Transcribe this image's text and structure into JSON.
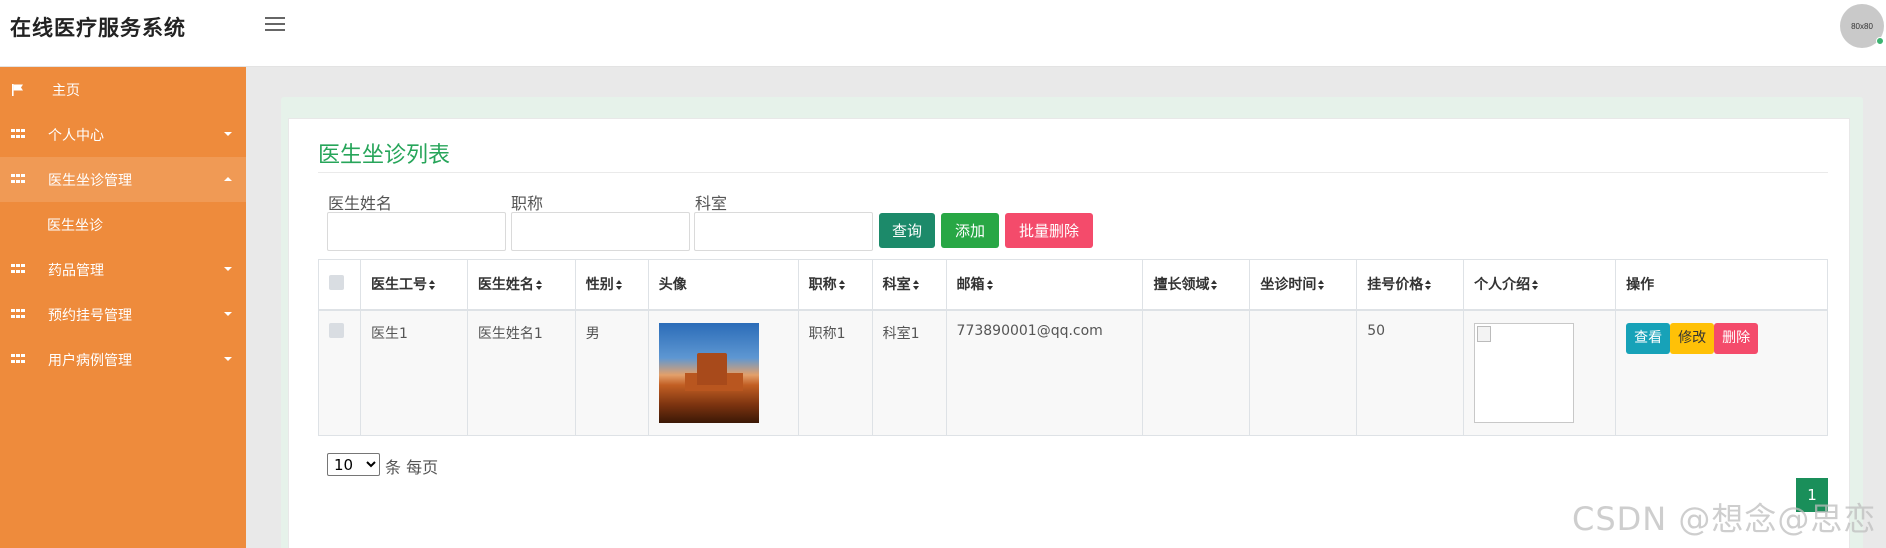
{
  "header": {
    "title": "在线医疗服务系统",
    "avatar_text": "80x80"
  },
  "sidebar": {
    "items": [
      {
        "label": "主页",
        "icon": "flag-icon"
      },
      {
        "label": "个人中心",
        "icon": "grid-icon"
      },
      {
        "label": "医生坐诊管理",
        "icon": "grid-icon",
        "expanded": true
      },
      {
        "label": "医生坐诊",
        "sub": true
      },
      {
        "label": "药品管理",
        "icon": "grid-icon"
      },
      {
        "label": "预约挂号管理",
        "icon": "grid-icon"
      },
      {
        "label": "用户病例管理",
        "icon": "grid-icon"
      }
    ]
  },
  "page": {
    "title": "医生坐诊列表"
  },
  "search": {
    "name_label": "医生姓名",
    "name_value": "",
    "title_label": "职称",
    "title_value": "",
    "dept_label": "科室",
    "dept_value": "",
    "query_button": "查询",
    "add_button": "添加",
    "batch_delete_button": "批量删除"
  },
  "table": {
    "headers": [
      "医生工号",
      "医生姓名",
      "性别",
      "头像",
      "职称",
      "科室",
      "邮箱",
      "擅长领域",
      "坐诊时间",
      "挂号价格",
      "个人介绍",
      "操作"
    ],
    "rows": [
      {
        "doctor_id": "医生1",
        "doctor_name": "医生姓名1",
        "gender": "男",
        "title": "职称1",
        "department": "科室1",
        "email": "773890001@qq.com",
        "specialty": "",
        "schedule": "",
        "price": "50",
        "actions": {
          "view": "查看",
          "edit": "修改",
          "delete": "删除"
        }
      }
    ]
  },
  "pagination": {
    "page_size": "10",
    "page_size_label": "条 每页",
    "current_page": "1"
  },
  "watermark": "CSDN @想念@思恋",
  "colors": {
    "sidebar": "#ee8b3c",
    "title_green": "#27a55a",
    "query": "#1c8a6a",
    "add": "#28a745",
    "danger": "#f44b6b",
    "info": "#17a2b8",
    "warning": "#ffc107"
  }
}
